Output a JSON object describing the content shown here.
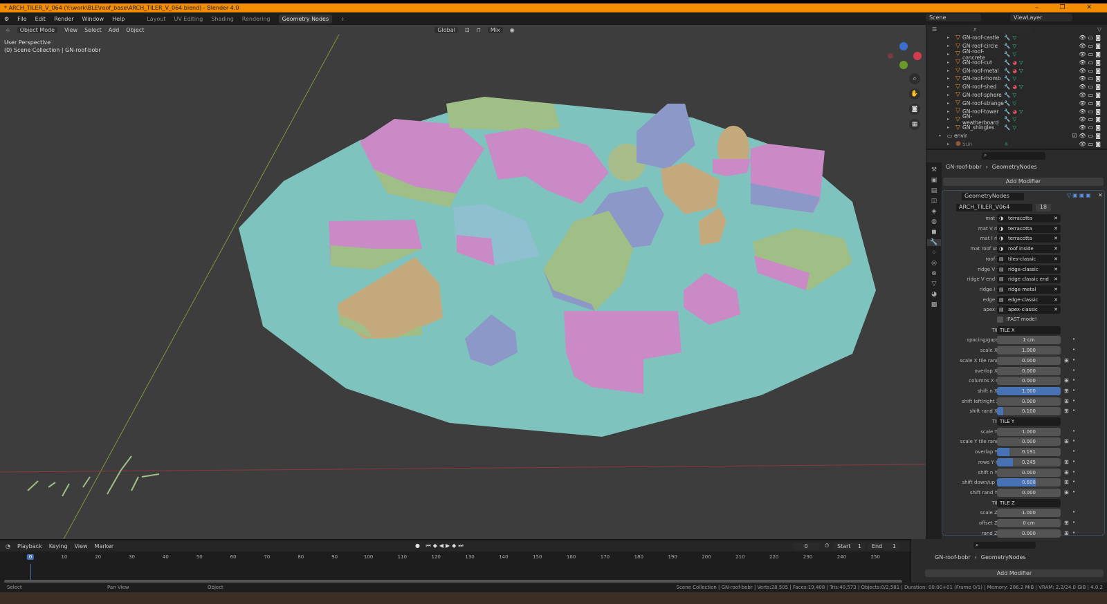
{
  "window": {
    "title": "* ARCH_TILER_V_064 (Y:\\work\\BLE\\roof_base\\ARCH_TILER_V_064.blend) - Blender 4.0",
    "controls": "– ❐ ✕"
  },
  "menu": {
    "items": [
      "File",
      "Edit",
      "Render",
      "Window",
      "Help"
    ],
    "workspaces": [
      "Layout",
      "UV Editing",
      "Shading",
      "Rendering",
      "Geometry Nodes"
    ],
    "active_workspace": "Geometry Nodes",
    "add_tab": "+"
  },
  "scene": {
    "scene_name": "Scene",
    "view_layer": "ViewLayer"
  },
  "viewport": {
    "mode": "Object Mode",
    "menus": [
      "View",
      "Select",
      "Add",
      "Object"
    ],
    "orientation": "Global",
    "snap_mode": "Mix",
    "perspective": "User Perspective",
    "collection_info": "(0) Scene Collection | GN-roof-bobr",
    "gizmo": {
      "z": "Z",
      "x": "X",
      "y": "Y"
    },
    "colors": {
      "floor": "#7fc3bf",
      "pink": "#c98ac6",
      "green": "#9fbf86",
      "blue": "#8c98c8",
      "tan": "#c4a97c",
      "background": "#3d3d3d"
    }
  },
  "outliner": {
    "items": [
      {
        "name": "GN-roof-castle",
        "mat": false
      },
      {
        "name": "GN-roof-circle",
        "mat": false
      },
      {
        "name": "GN-roof-concrete",
        "mat": false
      },
      {
        "name": "GN-roof-cut",
        "mat": true
      },
      {
        "name": "GN-roof-metal",
        "mat": true
      },
      {
        "name": "GN-roof-rhomb",
        "mat": false
      },
      {
        "name": "GN-roof-shed",
        "mat": true
      },
      {
        "name": "GN-roof-sphere",
        "mat": false
      },
      {
        "name": "GN-roof-strange",
        "mat": false
      },
      {
        "name": "GN-roof-tower",
        "mat": true
      },
      {
        "name": "GN-weatherboard",
        "mat": false
      },
      {
        "name": "GN_shingles",
        "mat": false
      }
    ],
    "collection": "envir",
    "light": "Sun"
  },
  "properties": {
    "object": "GN-roof-bobr",
    "modifier_breadcrumb": "GeometryNodes",
    "add_modifier": "Add Modifier",
    "modifier_name": "GeometryNodes",
    "node_group": "ARCH_TILER_V064",
    "users": "18",
    "rows": [
      {
        "label": "mat tiles",
        "type": "material",
        "value": "terracotta"
      },
      {
        "label": "mat V ridge",
        "type": "material",
        "value": "terracotta"
      },
      {
        "label": "mat I ridge",
        "type": "material",
        "value": "terracotta"
      },
      {
        "label": "mat roof under",
        "type": "material",
        "value": "roof inside"
      },
      {
        "label": "roof tiles",
        "type": "collection",
        "value": "tiles-classic"
      },
      {
        "label": "ridge V tiles",
        "type": "collection",
        "value": "ridge-classic"
      },
      {
        "label": "ridge V end tiles",
        "type": "collection",
        "value": "ridge classic end"
      },
      {
        "label": "ridge I tiles",
        "type": "collection",
        "value": "ridge metal"
      },
      {
        "label": "edge tiles",
        "type": "collection",
        "value": "edge-classic"
      },
      {
        "label": "apex tiles",
        "type": "collection",
        "value": "apex-classic"
      },
      {
        "label": "",
        "type": "checkbox",
        "value": "!FAST mode!",
        "checked": false
      },
      {
        "label": "TILE X",
        "type": "header",
        "value": "TILE X"
      },
      {
        "label": "spacing/gaps XY",
        "type": "number",
        "value": "1 cm",
        "fill": 0,
        "key": false
      },
      {
        "label": "scale X tile",
        "type": "number",
        "value": "1.000",
        "fill": 0,
        "key": false
      },
      {
        "label": "scale X tile random",
        "type": "number",
        "value": "0.000",
        "fill": 0,
        "key": true
      },
      {
        "label": "overlap X tile",
        "type": "number",
        "value": "0.000",
        "fill": 0,
        "key": false
      },
      {
        "label": "columns X rand",
        "type": "number",
        "value": "0.000",
        "fill": 0,
        "key": true
      },
      {
        "label": "shift n X tile",
        "type": "number",
        "value": "1.000",
        "fill": 1,
        "key": true
      },
      {
        "label": "shift left/right X all",
        "type": "number",
        "value": "0.000",
        "fill": 0,
        "key": true
      },
      {
        "label": "shift rand X tile",
        "type": "number",
        "value": "0.100",
        "fill": 0.1,
        "key": true
      },
      {
        "label": "TILE Y",
        "type": "header",
        "value": "TILE Y"
      },
      {
        "label": "scale Y tile",
        "type": "number",
        "value": "1.000",
        "fill": 0,
        "key": false
      },
      {
        "label": "scale Y tile random",
        "type": "number",
        "value": "0.000",
        "fill": 0,
        "key": true
      },
      {
        "label": "overlap Y tile",
        "type": "number",
        "value": "0.191",
        "fill": 0.191,
        "key": false
      },
      {
        "label": "rows Y rand",
        "type": "number",
        "value": "0.245",
        "fill": 0.245,
        "key": true
      },
      {
        "label": "shift n Y tile",
        "type": "number",
        "value": "0.000",
        "fill": 0,
        "key": true
      },
      {
        "label": "shift down/up Y all",
        "type": "number",
        "value": "0.608",
        "fill": 0.608,
        "key": true
      },
      {
        "label": "shift rand Y tile",
        "type": "number",
        "value": "0.000",
        "fill": 0,
        "key": true
      },
      {
        "label": "TILE Z",
        "type": "header",
        "value": "TILE Z"
      },
      {
        "label": "scale Z tile",
        "type": "number",
        "value": "1.000",
        "fill": 0,
        "key": false
      },
      {
        "label": "offset Z tile",
        "type": "number",
        "value": "0 cm",
        "fill": 0,
        "key": true
      },
      {
        "label": "rand Z tile",
        "type": "number",
        "value": "0.000",
        "fill": 0,
        "key": true
      }
    ]
  },
  "timeline": {
    "menus": [
      "Playback",
      "Keying",
      "View",
      "Marker"
    ],
    "current_frame": "0",
    "start_label": "Start",
    "start": "1",
    "end_label": "End",
    "end": "1",
    "ticks": [
      "0",
      "10",
      "20",
      "30",
      "40",
      "50",
      "60",
      "70",
      "80",
      "90",
      "100",
      "110",
      "120",
      "130",
      "140",
      "150",
      "160",
      "170",
      "180",
      "190",
      "200",
      "210",
      "220",
      "230",
      "240",
      "250"
    ]
  },
  "properties2": {
    "object": "GN-roof-bobr",
    "modifier_breadcrumb": "GeometryNodes",
    "add_modifier": "Add Modifier"
  },
  "status": {
    "hints": [
      "Select",
      "Pan View",
      "Object"
    ],
    "stats": "Scene Collection | GN-roof-bobr | Verts:28,505 | Faces:19,408 | Tris:40,573 | Objects:0/2,581 | Duration: 00:00+01 (Frame 0/1) | Memory: 286.2 MiB | VRAM: 2.2/24.0 GiB | 4.0.2"
  }
}
